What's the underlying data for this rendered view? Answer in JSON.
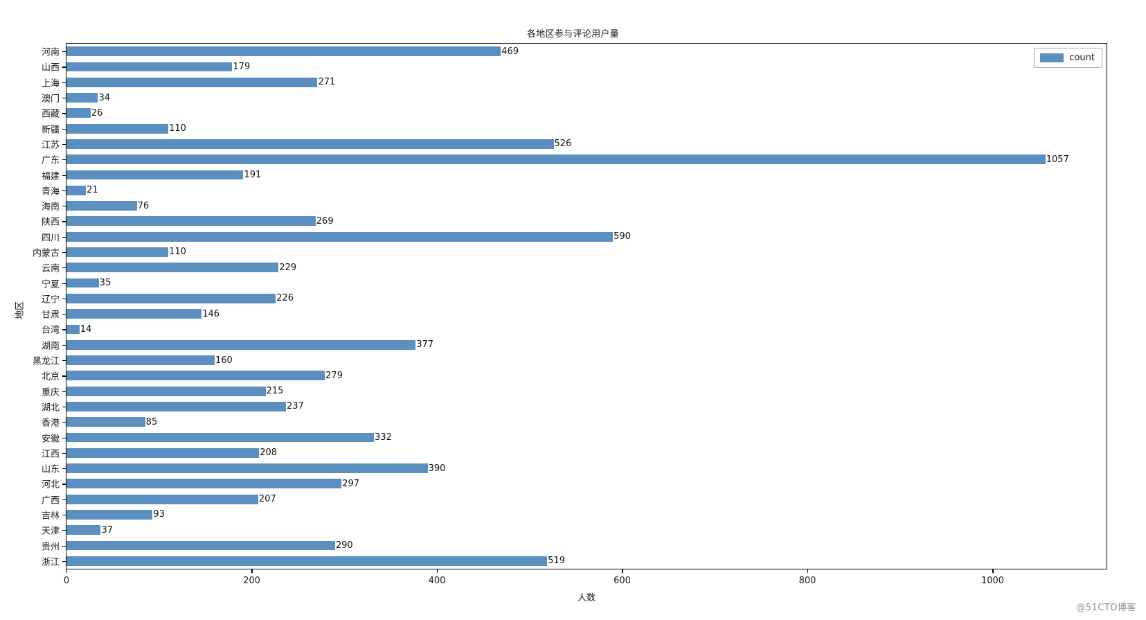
{
  "chart_data": {
    "type": "bar",
    "orientation": "horizontal",
    "title": "各地区参与评论用户量",
    "xlabel": "人数",
    "ylabel": "地区",
    "legend": {
      "position": "upper-right",
      "entries": [
        "count"
      ]
    },
    "series_name": "count",
    "bar_color": "#5b8fc0",
    "grid": false,
    "xlim": [
      0,
      1123
    ],
    "xticks": [
      0,
      200,
      400,
      600,
      800,
      1000
    ],
    "xtick_labels": [
      "0",
      "200",
      "400",
      "600",
      "800",
      "1000"
    ],
    "categories": [
      "河南",
      "山西",
      "上海",
      "澳门",
      "西藏",
      "新疆",
      "江苏",
      "广东",
      "福建",
      "青海",
      "海南",
      "陕西",
      "四川",
      "内蒙古",
      "云南",
      "宁夏",
      "辽宁",
      "甘肃",
      "台湾",
      "湖南",
      "黑龙江",
      "北京",
      "重庆",
      "湖北",
      "香港",
      "安徽",
      "江西",
      "山东",
      "河北",
      "广西",
      "吉林",
      "天津",
      "贵州",
      "浙江"
    ],
    "values": [
      469,
      179,
      271,
      34,
      26,
      110,
      526,
      1057,
      191,
      21,
      76,
      269,
      590,
      110,
      229,
      35,
      226,
      146,
      14,
      377,
      160,
      279,
      215,
      237,
      85,
      332,
      208,
      390,
      297,
      207,
      93,
      37,
      290,
      519
    ],
    "value_labels": [
      "469",
      "179",
      "271",
      "34",
      "26",
      "110",
      "526",
      "1057",
      "191",
      "21",
      "76",
      "269",
      "590",
      "110",
      "229",
      "35",
      "226",
      "146",
      "14",
      "377",
      "160",
      "279",
      "215",
      "237",
      "85",
      "332",
      "208",
      "390",
      "297",
      "207",
      "93",
      "37",
      "290",
      "519"
    ]
  },
  "watermark": "@51CTO博客"
}
